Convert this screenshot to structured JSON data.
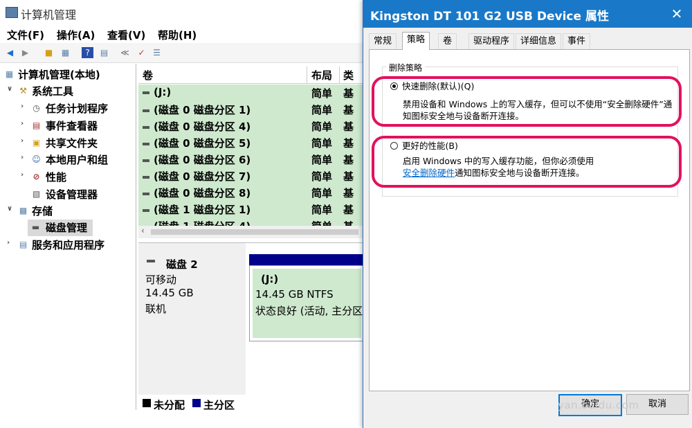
{
  "main_window": {
    "title": "计算机管理",
    "menu": [
      "文件(F)",
      "操作(A)",
      "查看(V)",
      "帮助(H)"
    ],
    "toolbar_icons": [
      "back-arrow-icon",
      "forward-arrow-icon",
      "up-folder-icon",
      "console-tree-icon",
      "help-icon",
      "properties-icon",
      "connect-icon",
      "checklist-icon",
      "list-view-icon"
    ]
  },
  "tree": {
    "root": "计算机管理(本地)",
    "system_tools": "系统工具",
    "items": [
      {
        "label": "任务计划程序",
        "icon": "clock-icon"
      },
      {
        "label": "事件查看器",
        "icon": "event-viewer-icon"
      },
      {
        "label": "共享文件夹",
        "icon": "shared-folder-icon"
      },
      {
        "label": "本地用户和组",
        "icon": "users-icon"
      },
      {
        "label": "性能",
        "icon": "performance-icon"
      },
      {
        "label": "设备管理器",
        "icon": "device-manager-icon"
      }
    ],
    "storage": "存储",
    "disk_management": "磁盘管理",
    "services": "服务和应用程序"
  },
  "volume_list": {
    "headers": [
      "卷",
      "布局",
      "类型"
    ],
    "rows": [
      {
        "volume": "(J:)",
        "layout": "简单",
        "type": "基本"
      },
      {
        "volume": "(磁盘 0 磁盘分区 1)",
        "layout": "简单",
        "type": "基本"
      },
      {
        "volume": "(磁盘 0 磁盘分区 4)",
        "layout": "简单",
        "type": "基本"
      },
      {
        "volume": "(磁盘 0 磁盘分区 5)",
        "layout": "简单",
        "type": "基本"
      },
      {
        "volume": "(磁盘 0 磁盘分区 6)",
        "layout": "简单",
        "type": "基本"
      },
      {
        "volume": "(磁盘 0 磁盘分区 7)",
        "layout": "简单",
        "type": "基本"
      },
      {
        "volume": "(磁盘 0 磁盘分区 8)",
        "layout": "简单",
        "type": "基本"
      },
      {
        "volume": "(磁盘 1 磁盘分区 1)",
        "layout": "简单",
        "type": "基本"
      },
      {
        "volume": "(磁盘 1 磁盘分区 4)",
        "layout": "简单",
        "type": "基本"
      }
    ]
  },
  "disk_view": {
    "disk_name": "磁盘 2",
    "disk_type": "可移动",
    "disk_size": "14.45 GB",
    "disk_status": "联机",
    "partition_name": "(J:)",
    "partition_size": "14.45 GB NTFS",
    "partition_status": "状态良好 (活动, 主分区"
  },
  "legend": {
    "unallocated": "未分配",
    "primary": "主分区"
  },
  "dialog": {
    "title": "Kingston DT 101 G2 USB Device 属性",
    "tabs": [
      "常规",
      "策略",
      "卷",
      "驱动程序",
      "详细信息",
      "事件"
    ],
    "active_tab": "策略",
    "group_label": "删除策略",
    "option1_label": "快速删除(默认)(Q)",
    "option1_desc_line1": "禁用设备和 Windows 上的写入缓存，但可以不使用“安全删除硬件”通",
    "option1_desc_line2": "知图标安全地与设备断开连接。",
    "option2_label": "更好的性能(B)",
    "option2_desc_line1": "启用 Windows 中的写入缓存功能，但你必须使用",
    "option2_link": "安全删除硬件",
    "option2_desc_line2": "通知图标安全地与设备断开连接。",
    "ok_label": "确定",
    "cancel_label": "取消"
  },
  "watermark": "yan.baidu.com",
  "colors": {
    "highlight_ring": "#e2115e",
    "dialog_titlebar": "#1979c8",
    "partition_fill": "#cfe9cf",
    "primary_partition": "#00008b"
  }
}
